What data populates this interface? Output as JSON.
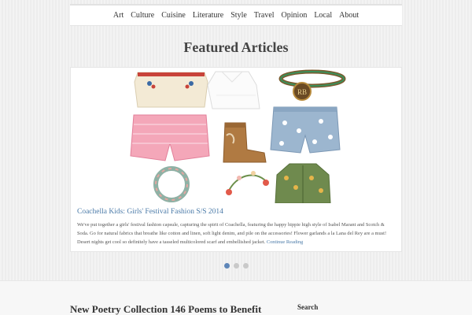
{
  "nav": {
    "items": [
      "Art",
      "Culture",
      "Cuisine",
      "Literature",
      "Style",
      "Travel",
      "Opinion",
      "Local",
      "About"
    ]
  },
  "section_title": "Featured Articles",
  "featured": {
    "title": "Coachella Kids: Girls' Festival Fashion S/S 2014",
    "excerpt": "We've put together a girls' festival fashion capsule, capturing the spirit of Coachella, featuring the happy hippie high style of Isabel Marant and Scotch & Soda. Go for natural fabrics that breathe like cotton and linen, soft light denim, and pile on the accessories! Flower garlands a la Lana del Rey are a must! Desert nights get cool so definitely have a tasseled multicolored scarf and embellished jacket.",
    "read_more": "Continue Reading",
    "collage_label": "RB"
  },
  "slider": {
    "slide_count": 3,
    "active_index": 0
  },
  "lower": {
    "post_title": "New Poetry Collection 146 Poems to Benefit",
    "sidebar_heading": "Search"
  },
  "colors": {
    "link": "#4a7aa8",
    "active_dot": "#5e86b8"
  }
}
